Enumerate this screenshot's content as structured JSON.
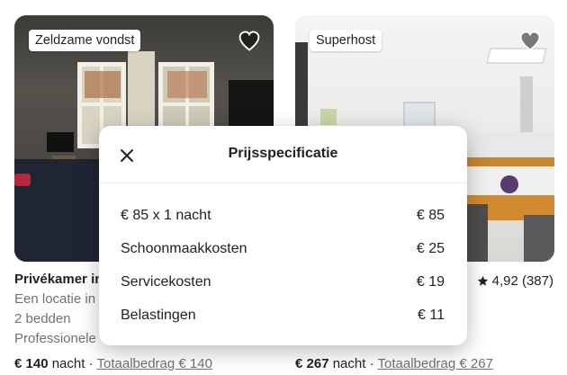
{
  "listings": [
    {
      "badge": "Zeldzame vondst",
      "title": "Privékamer in",
      "lines": [
        "Een locatie in",
        "2 bedden",
        "Professionele"
      ],
      "price": "€ 140",
      "price_unit": "nacht",
      "separator": "·",
      "total": "Totaalbedrag € 140"
    },
    {
      "badge": "Superhost",
      "rating": "4,92 (387)",
      "price": "€ 267",
      "price_unit": "nacht",
      "separator": "·",
      "total": "Totaalbedrag € 267"
    }
  ],
  "modal": {
    "title": "Prijsspecificatie",
    "close_icon": "close-icon",
    "rows": [
      {
        "label": "€ 85 x 1 nacht",
        "value": "€ 85"
      },
      {
        "label": "Schoonmaakkosten",
        "value": "€ 25"
      },
      {
        "label": "Servicekosten",
        "value": "€ 19"
      },
      {
        "label": "Belastingen",
        "value": "€ 11"
      }
    ]
  },
  "icons": [
    "heart-icon",
    "star-icon",
    "close-icon"
  ],
  "colors": {
    "text": "#222222",
    "muted": "#717171",
    "overlay_bg": "#ffffff"
  }
}
